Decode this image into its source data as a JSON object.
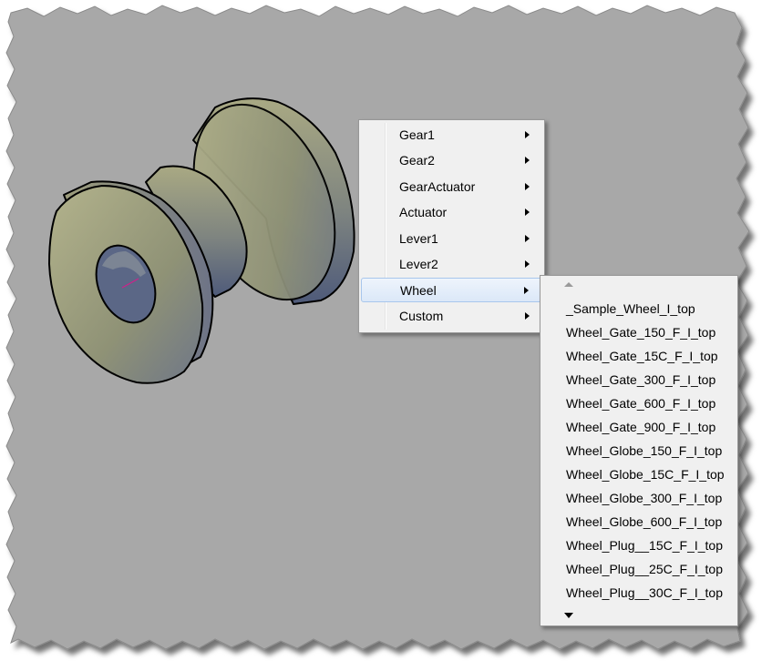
{
  "context_menu": {
    "items": [
      {
        "label": "Gear1",
        "has_submenu": true
      },
      {
        "label": "Gear2",
        "has_submenu": true
      },
      {
        "label": "GearActuator",
        "has_submenu": true
      },
      {
        "label": "Actuator",
        "has_submenu": true
      },
      {
        "label": "Lever1",
        "has_submenu": true
      },
      {
        "label": "Lever2",
        "has_submenu": true
      },
      {
        "label": "Wheel",
        "has_submenu": true,
        "highlighted": true
      },
      {
        "label": "Custom",
        "has_submenu": true
      }
    ]
  },
  "wheel_submenu": {
    "items": [
      "_Sample_Wheel_I_top",
      "Wheel_Gate_150_F_I_top",
      "Wheel_Gate_15C_F_I_top",
      "Wheel_Gate_300_F_I_top",
      "Wheel_Gate_600_F_I_top",
      "Wheel_Gate_900_F_I_top",
      "Wheel_Globe_150_F_I_top",
      "Wheel_Globe_15C_F_I_top",
      "Wheel_Globe_300_F_I_top",
      "Wheel_Globe_600_F_I_top",
      "Wheel_Plug__15C_F_I_top",
      "Wheel_Plug__25C_F_I_top",
      "Wheel_Plug__30C_F_I_top"
    ],
    "scroll_up_icon": "triangle-up-icon",
    "scroll_down_icon": "triangle-down-icon"
  },
  "colors": {
    "viewport_background": "#a8a8a8",
    "model_face": "#9c9a78",
    "model_shadow": "#5c6680",
    "menu_background": "#f0f0f0",
    "menu_highlight": "#dbe8f8"
  }
}
